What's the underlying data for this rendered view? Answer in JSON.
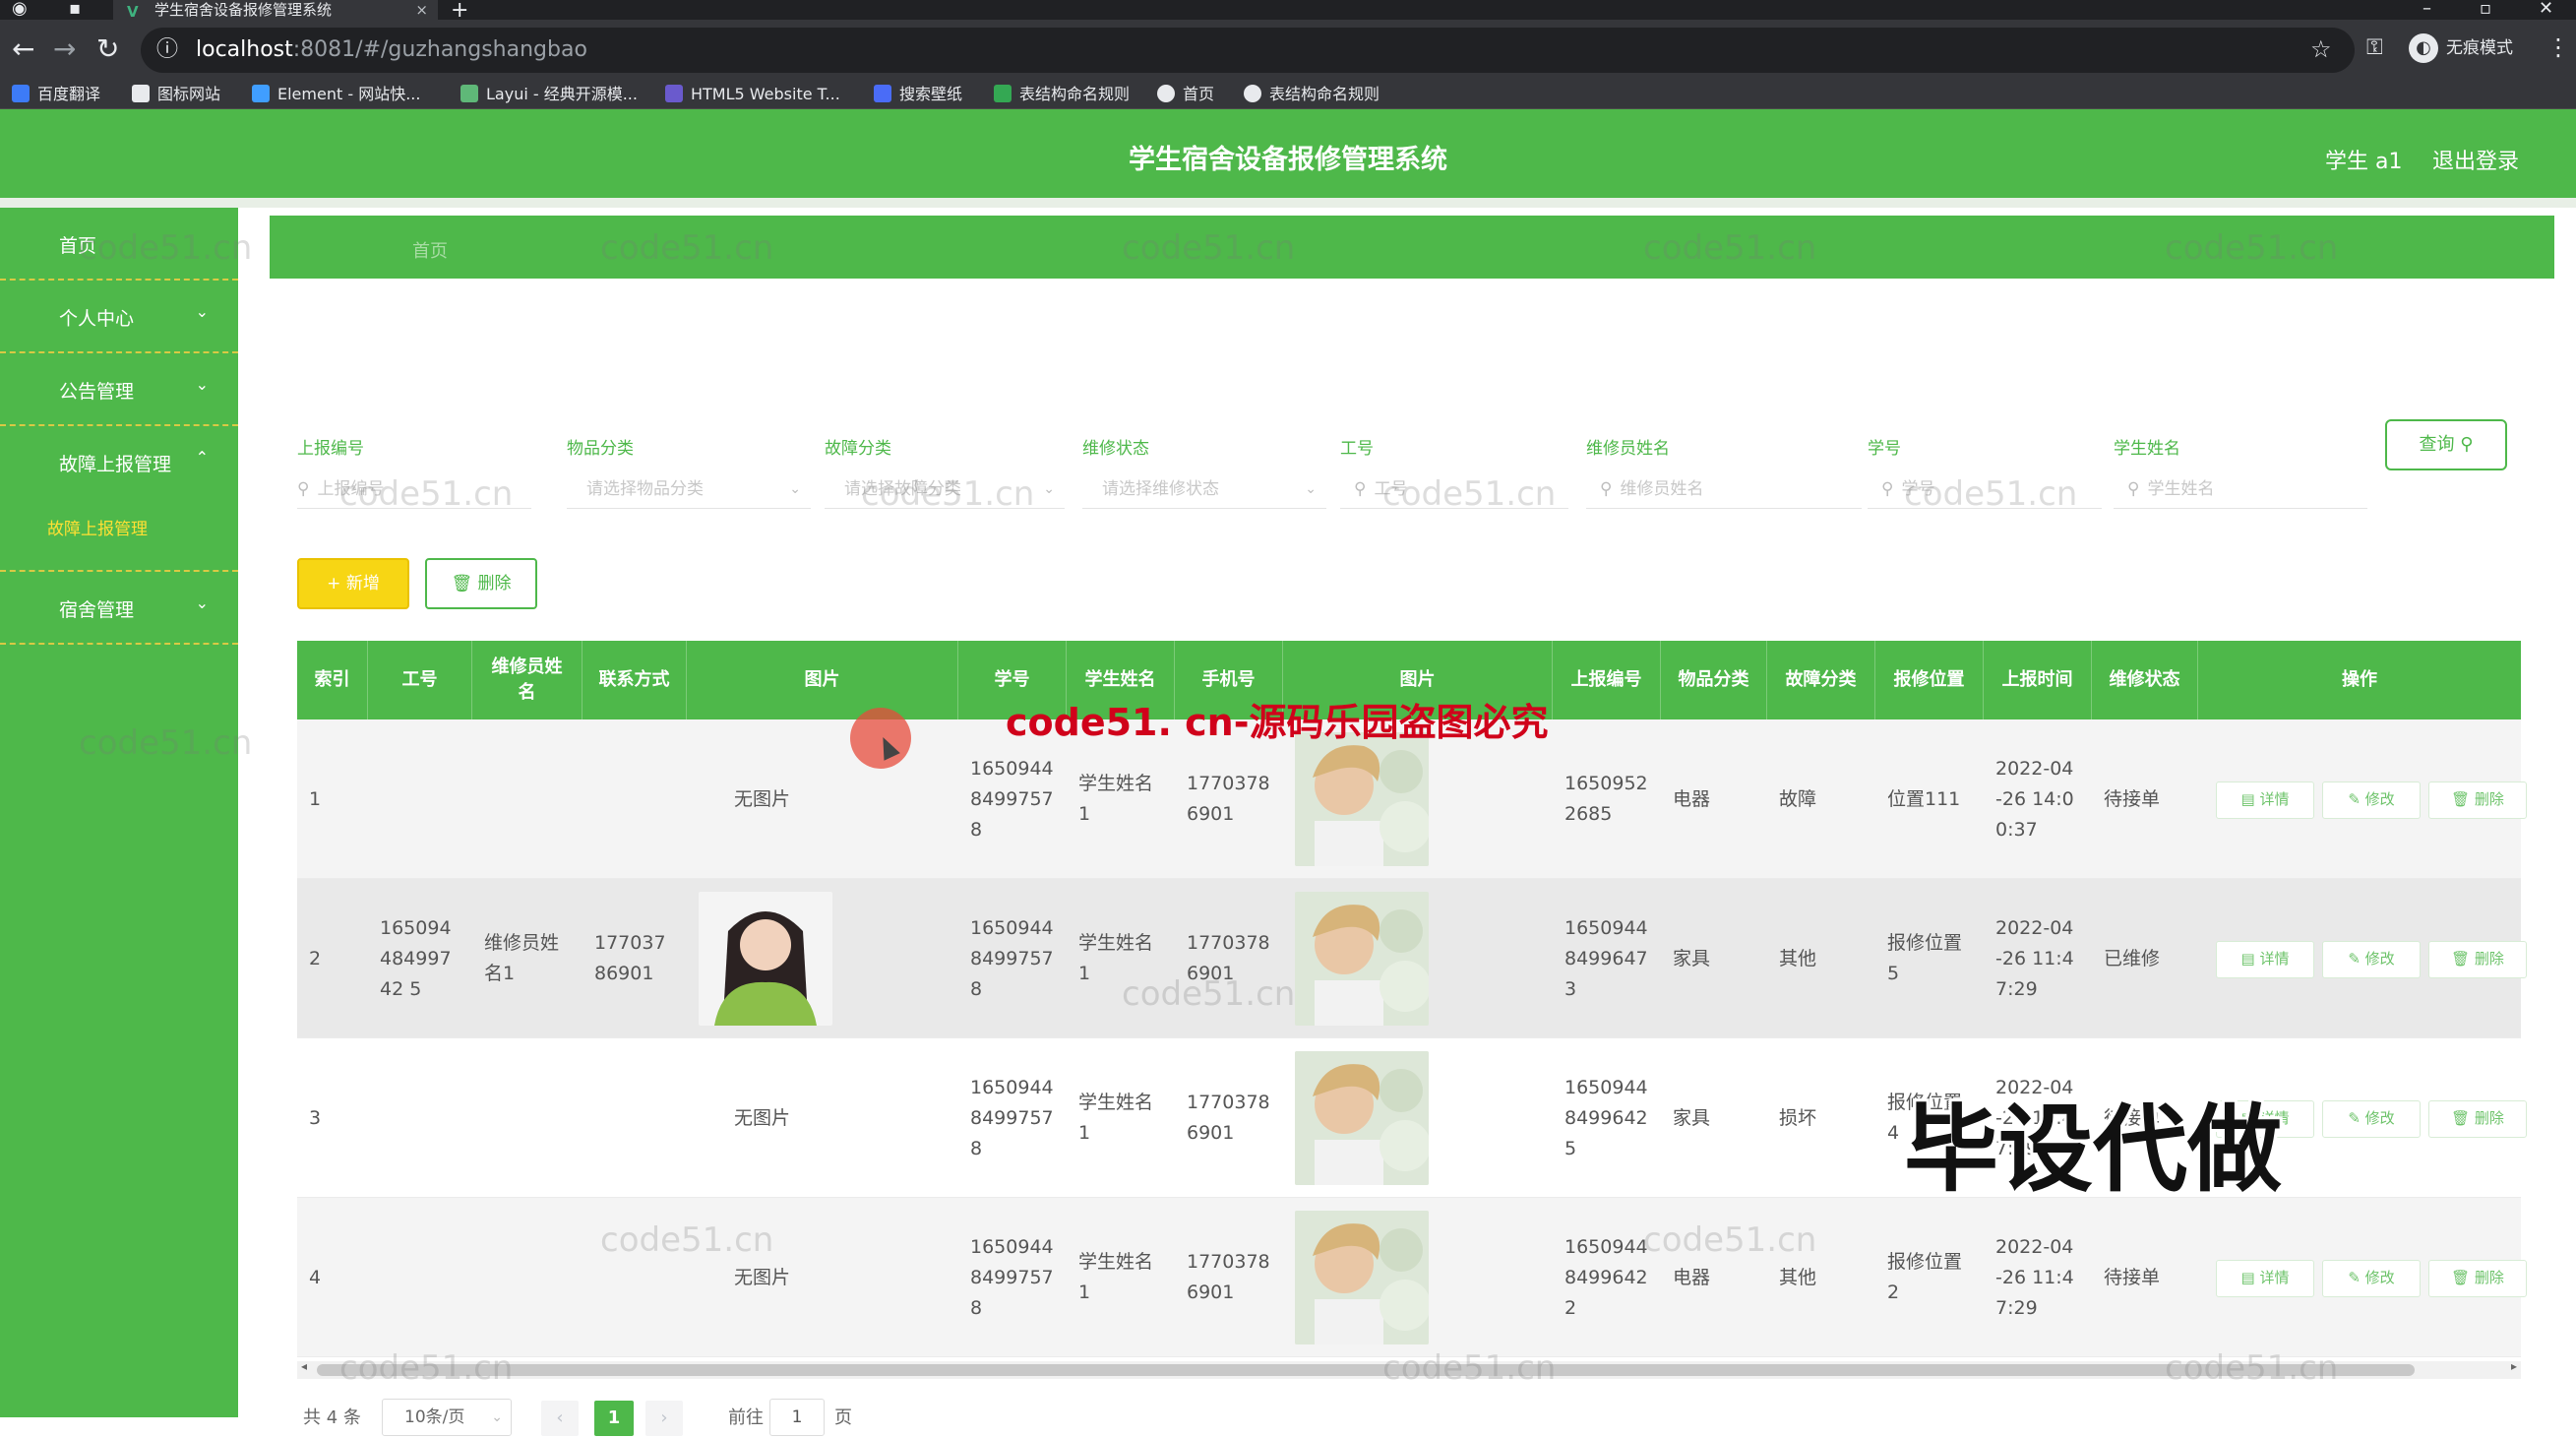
{
  "browser": {
    "tab_title": "学生宿舍设备报修管理系统",
    "tab_close": "×",
    "newtab": "+",
    "url_host": "localhost",
    "url_path": ":8081/#/guzhangshangbao",
    "profile_label": "无痕模式",
    "bookmarks": [
      "百度翻译",
      "图标网站",
      "Element - 网站快...",
      "Layui - 经典开源模...",
      "HTML5 Website T...",
      "搜索壁纸",
      "表结构命名规则",
      "首页",
      "表结构命名规则"
    ]
  },
  "header": {
    "title": "学生宿舍设备报修管理系统",
    "user": "学生 a1",
    "logout": "退出登录"
  },
  "sidebar": {
    "items": [
      {
        "label": "首页",
        "arrow": ""
      },
      {
        "label": "个人中心",
        "arrow": "⌄"
      },
      {
        "label": "公告管理",
        "arrow": "⌄"
      },
      {
        "label": "故障上报管理",
        "arrow": "⌃"
      },
      {
        "label": "宿舍管理",
        "arrow": "⌄"
      }
    ],
    "sub_item": "故障上报管理"
  },
  "breadcrumb": "首页",
  "filters": [
    {
      "label": "上报编号",
      "placeholder": "上报编号",
      "type": "text"
    },
    {
      "label": "物品分类",
      "placeholder": "请选择物品分类",
      "type": "select"
    },
    {
      "label": "故障分类",
      "placeholder": "请选择故障分类",
      "type": "select"
    },
    {
      "label": "维修状态",
      "placeholder": "请选择维修状态",
      "type": "select"
    },
    {
      "label": "工号",
      "placeholder": "工号",
      "type": "text"
    },
    {
      "label": "维修员姓名",
      "placeholder": "维修员姓名",
      "type": "text"
    },
    {
      "label": "学号",
      "placeholder": "学号",
      "type": "text"
    },
    {
      "label": "学生姓名",
      "placeholder": "学生姓名",
      "type": "text"
    }
  ],
  "buttons": {
    "query": "查询",
    "add": "+ 新增",
    "delete": "删除"
  },
  "table": {
    "columns": [
      "索引",
      "工号",
      "维修员姓名",
      "联系方式",
      "图片",
      "学号",
      "学生姓名",
      "手机号",
      "图片",
      "上报编号",
      "物品分类",
      "故障分类",
      "报修位置",
      "上报时间",
      "维修状态",
      "操作"
    ],
    "rows": [
      {
        "index": "1",
        "worker_id": "",
        "worker_name": "",
        "contact": "",
        "photo1": "无图片",
        "student_no": "16509448499757 8",
        "student_name": "学生姓名 1",
        "phone": "17703786901",
        "report_no": "16509522685",
        "item_type": "电器",
        "fault_type": "故障",
        "location": "位置111",
        "time": "2022-04-26 14:00:37",
        "status": "待接单"
      },
      {
        "index": "2",
        "worker_id": "16509448499742 5",
        "worker_name": "维修员姓名1",
        "contact": "17703786901",
        "photo1": "",
        "student_no": "16509448499757 8",
        "student_name": "学生姓名 1",
        "phone": "17703786901",
        "report_no": "16509448499647 3",
        "item_type": "家具",
        "fault_type": "其他",
        "location": "报修位置 5",
        "time": "2022-04-26 11:47:29",
        "status": "已维修"
      },
      {
        "index": "3",
        "worker_id": "",
        "worker_name": "",
        "contact": "",
        "photo1": "无图片",
        "student_no": "16509448499757 8",
        "student_name": "学生姓名 1",
        "phone": "17703786901",
        "report_no": "16509448499642 5",
        "item_type": "家具",
        "fault_type": "损坏",
        "location": "报修位置 4",
        "time": "2022-04-26 11:47:29",
        "status": "待接单"
      },
      {
        "index": "4",
        "worker_id": "",
        "worker_name": "",
        "contact": "",
        "photo1": "无图片",
        "student_no": "16509448499757 8",
        "student_name": "学生姓名 1",
        "phone": "17703786901",
        "report_no": "16509448499642 2",
        "item_type": "电器",
        "fault_type": "其他",
        "location": "报修位置 2",
        "time": "2022-04-26 11:47:29",
        "status": "待接单"
      }
    ],
    "actions": [
      "详情",
      "修改",
      "删除"
    ]
  },
  "pagination": {
    "total": "共 4 条",
    "page_size": "10条/页",
    "current": "1",
    "goto": "前往",
    "goto_value": "1",
    "page_unit": "页"
  },
  "overlays": {
    "watermark": "code51.cn",
    "red_watermark": "code51. cn-源码乐园盗图必究",
    "big_watermark": "毕设代做"
  },
  "colors": {
    "primary": "#4eb84a",
    "accent_yellow": "#f7d614"
  }
}
